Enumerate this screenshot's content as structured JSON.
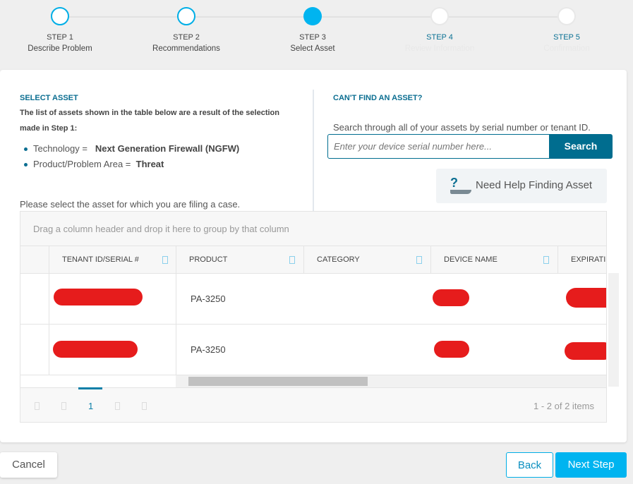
{
  "steps": [
    {
      "number": "STEP 1",
      "label": "Describe Problem",
      "state": "done"
    },
    {
      "number": "STEP 2",
      "label": "Recommendations",
      "state": "done"
    },
    {
      "number": "STEP 3",
      "label": "Select Asset",
      "state": "current"
    },
    {
      "number": "STEP 4",
      "label": "Review Information",
      "state": "todo"
    },
    {
      "number": "STEP 5",
      "label": "Confirmation",
      "state": "todo"
    }
  ],
  "select_asset": {
    "title": "SELECT ASSET",
    "intro": "The list of assets shown in the table below are a result of the selection made in Step 1:",
    "criteria": [
      {
        "key": "Technology =",
        "value": "Next Generation Firewall (NGFW)"
      },
      {
        "key": "Product/Problem Area =",
        "value": "Threat"
      }
    ],
    "instruction": "Please select the asset for which you are filing a case."
  },
  "find_asset": {
    "title": "CAN'T FIND AN ASSET?",
    "description": "Search through all of your assets by serial number or tenant ID.",
    "placeholder": "Enter your device serial number here...",
    "search_label": "Search",
    "help_label": "Need Help Finding Asset"
  },
  "grid": {
    "group_hint": "Drag a column header and drop it here to group by that column",
    "columns": [
      "TENANT ID/SERIAL #",
      "PRODUCT",
      "CATEGORY",
      "DEVICE NAME",
      "EXPIRATI"
    ],
    "rows": [
      {
        "product": "PA-3250"
      },
      {
        "product": "PA-3250"
      }
    ],
    "pager": {
      "current_page": "1",
      "summary": "1 - 2 of 2 items"
    }
  },
  "footer": {
    "cancel": "Cancel",
    "back": "Back",
    "next": "Next Step"
  },
  "colors": {
    "accent": "#00b4f0",
    "brand": "#006d8f",
    "redaction": "#e61c1c"
  }
}
